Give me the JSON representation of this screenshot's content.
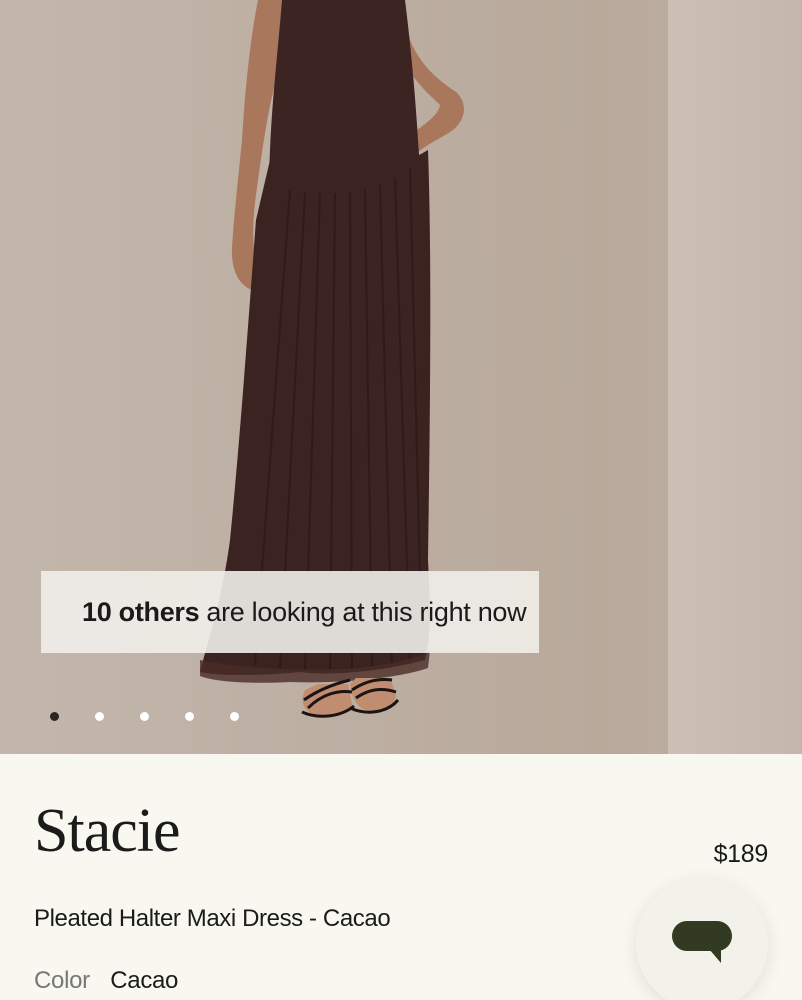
{
  "product": {
    "name": "Stacie",
    "price": "$189",
    "subtitle": "Pleated Halter Maxi Dress - Cacao",
    "color_label": "Color",
    "color_value": "Cacao"
  },
  "gallery": {
    "viewers_count": "10 others",
    "viewers_text": "are looking at this right now",
    "image_count": 5,
    "active_index": 0
  },
  "chat": {
    "icon": "chat-bubble-icon",
    "color": "#333a22"
  },
  "colors": {
    "dress": "#3a2320",
    "background": "#f8f7f0"
  }
}
